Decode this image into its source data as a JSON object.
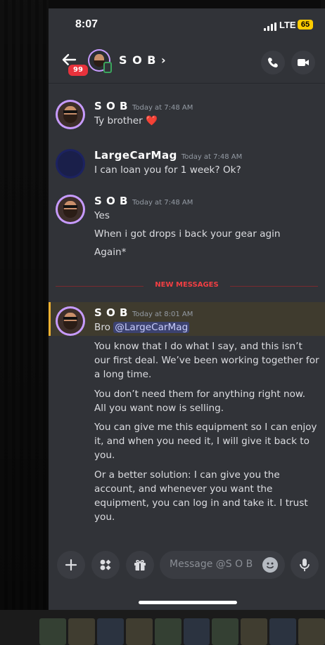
{
  "status_bar": {
    "time": "8:07",
    "network": "LTE",
    "battery": "65"
  },
  "header": {
    "title": "S O B",
    "chevron": "›",
    "badge": "99"
  },
  "messages": [
    {
      "author": "S O B",
      "timestamp": "Today at 7:48 AM",
      "lines": [
        "Ty brother"
      ],
      "emoji": "❤️"
    },
    {
      "author": "LargeCarMag",
      "timestamp": "Today at 7:48 AM",
      "lines": [
        "I can loan you for 1 week? Ok?"
      ]
    },
    {
      "author": "S O B",
      "timestamp": "Today at 7:48 AM",
      "lines": [
        "Yes",
        "When i got drops i back your gear agin",
        "Again*"
      ]
    },
    {
      "author": "S O B",
      "timestamp": "Today at 8:01 AM",
      "first_line": "Bro ",
      "mention": "@LargeCarMag",
      "paragraphs": [
        "You know that I do what I say, and this isn’t our first deal. We’ve been working together for a long time.",
        "You don’t need them for anything right now. All you want now is selling.",
        "You can give me this equipment so I can enjoy it, and when you need it, I will give it back to you.",
        "Or a better solution: I can give you the account, and whenever you want the equipment, you can log in and take it. I trust you."
      ]
    }
  ],
  "divider": {
    "label": "NEW MESSAGES"
  },
  "composer": {
    "placeholder": "Message @S O B"
  },
  "colors": {
    "background": "#313338",
    "accent_new": "#f23f43",
    "highlight_border": "#f0b232",
    "mention_bg": "#3c4270"
  }
}
